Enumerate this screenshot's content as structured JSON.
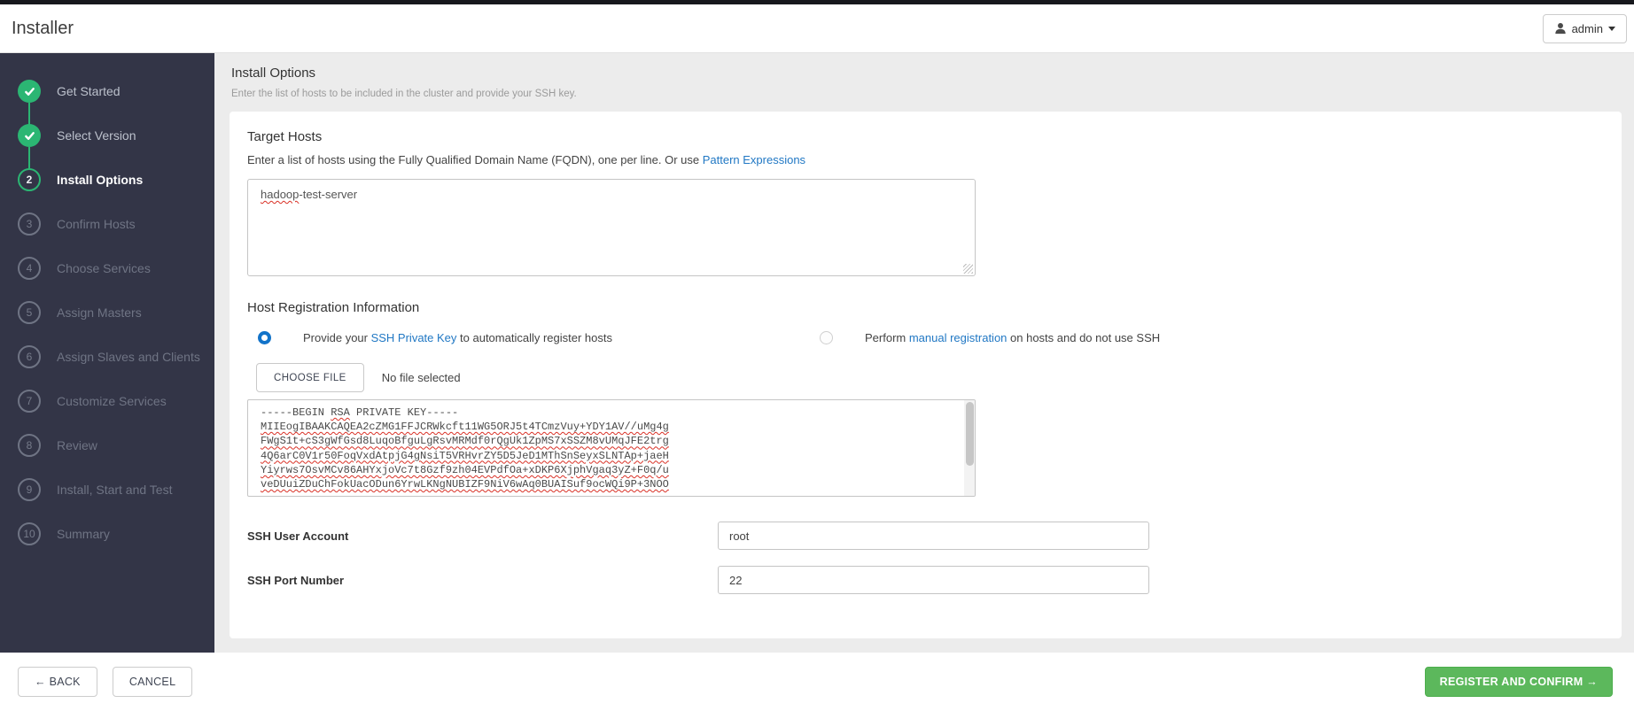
{
  "topbar": {
    "app_title": "Installer",
    "user_label": "admin"
  },
  "sidebar": {
    "steps": [
      {
        "label": "Get Started",
        "status": "done"
      },
      {
        "label": "Select Version",
        "status": "done"
      },
      {
        "label": "Install Options",
        "status": "active",
        "number": "2"
      },
      {
        "label": "Confirm Hosts",
        "status": "pending",
        "number": "3"
      },
      {
        "label": "Choose Services",
        "status": "pending",
        "number": "4"
      },
      {
        "label": "Assign Masters",
        "status": "pending",
        "number": "5"
      },
      {
        "label": "Assign Slaves and Clients",
        "status": "pending",
        "number": "6"
      },
      {
        "label": "Customize Services",
        "status": "pending",
        "number": "7"
      },
      {
        "label": "Review",
        "status": "pending",
        "number": "8"
      },
      {
        "label": "Install, Start and Test",
        "status": "pending",
        "number": "9"
      },
      {
        "label": "Summary",
        "status": "pending",
        "number": "10"
      }
    ]
  },
  "page": {
    "title": "Install Options",
    "subtitle": "Enter the list of hosts to be included in the cluster and provide your SSH key."
  },
  "target_hosts": {
    "heading": "Target Hosts",
    "description_prefix": "Enter a list of hosts using the Fully Qualified Domain Name (FQDN), one per line. Or use ",
    "link_label": "Pattern Expressions",
    "value_word": "hadoop",
    "value_rest": "-test-server"
  },
  "host_registration": {
    "heading": "Host Registration Information",
    "option_ssh": {
      "pre": "Provide your ",
      "link": "SSH Private Key",
      "post": " to automatically register hosts"
    },
    "option_manual": {
      "pre": "Perform ",
      "link": "manual registration",
      "post": " on hosts and do not use SSH"
    },
    "choose_file_label": "CHOOSE FILE",
    "file_status": "No file selected",
    "ssh_key": {
      "header_pre": "-----BEGIN ",
      "header_word": "RSA",
      "header_post": " PRIVATE KEY-----",
      "lines": [
        "MIIEogIBAAKCAQEA2cZMG1FFJCRWkcft11WG5ORJ5t4TCmzVuy+YDY1AV//uMg4g",
        "FWgS1t+cS3gWfGsd8LuqoBfguLgRsvMRMdf0rQgUk1ZpMS7xSSZM8vUMqJFE2trg",
        "4Q6arC0V1r50FoqVxdAtpjG4gNsiT5VRHvrZY5D5JeD1MThSnSeyxSLNTAp+jaeH",
        "Yiyrws7OsvMCv86AHYxjoVc7t8Gzf9zh04EVPdfOa+xDKP6XjphVgaq3yZ+F0q/u",
        "veDUuiZDuChFokUacODun6YrwLKNgNUBIZF9NiV6wAq0BUAISuf9ocWQi9P+3NOO"
      ]
    }
  },
  "form": {
    "ssh_user": {
      "label": "SSH User Account",
      "value": "root"
    },
    "ssh_port": {
      "label": "SSH Port Number",
      "value": "22"
    }
  },
  "footer": {
    "back_label": "← BACK",
    "cancel_label": "CANCEL",
    "register_label": "REGISTER AND CONFIRM →"
  },
  "colors": {
    "sidebar_bg": "#333547",
    "step_green": "#2bb673",
    "button_green": "#5cb85c",
    "link_blue": "#2178c4",
    "radio_blue": "#1273c9",
    "page_bg": "#ececec"
  }
}
